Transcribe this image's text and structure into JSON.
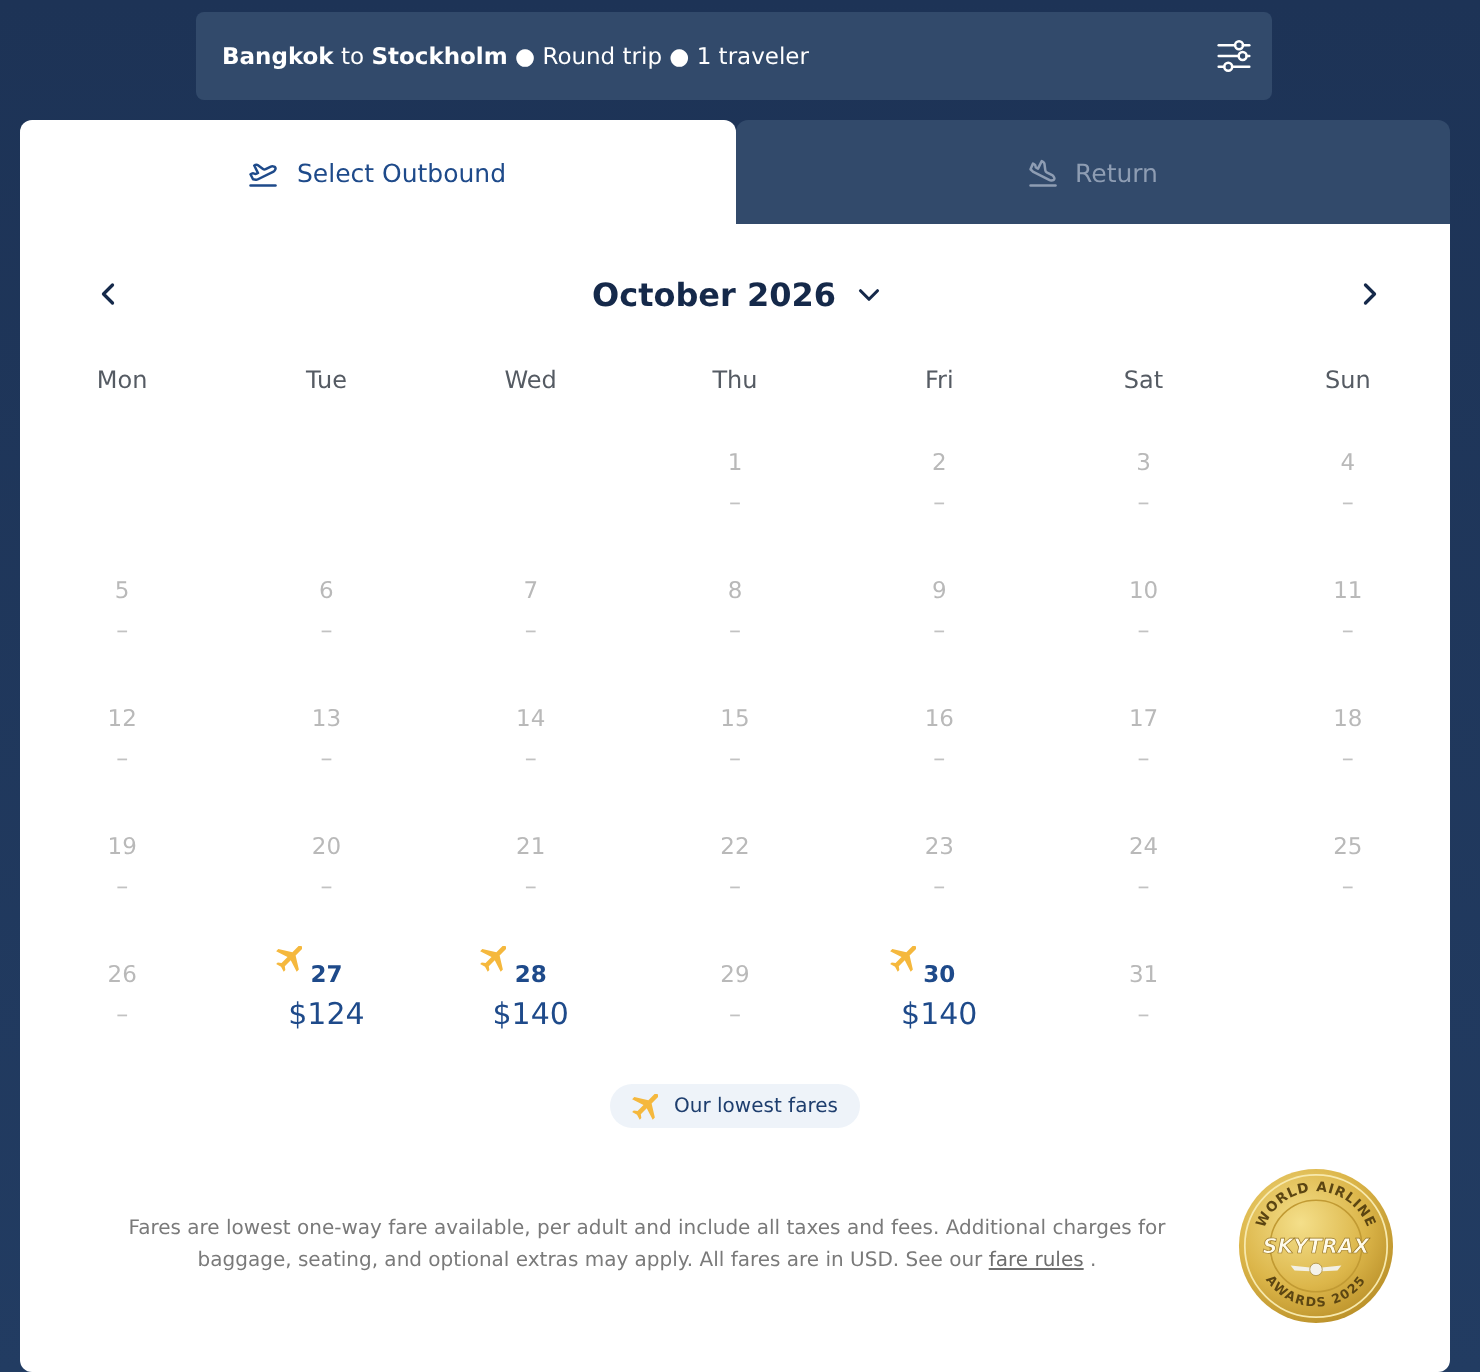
{
  "search_summary": {
    "text": "**Bangkok** to **Stockholm** ● Round trip ● 1 traveler"
  },
  "tabs": [
    {
      "kind": "outbound",
      "label": "Select Outbound",
      "selected": true
    },
    {
      "kind": "return",
      "label": "Return",
      "selected": false
    }
  ],
  "calendar": {
    "month": "October 2026",
    "weekdays": [
      "Mon",
      "Tue",
      "Wed",
      "Thu",
      "Fri",
      "Sat",
      "Sun"
    ],
    "weeks": [
      [
        {
          "day": "1",
          "available": false,
          "lowest_fare": false,
          "price": "–"
        },
        {
          "day": "2",
          "available": false,
          "lowest_fare": false,
          "price": "–"
        },
        {
          "day": "3",
          "available": false,
          "lowest_fare": false,
          "price": "–"
        },
        {
          "day": "4",
          "available": false,
          "lowest_fare": false,
          "price": "–"
        }
      ],
      [
        {
          "day": "5",
          "available": false,
          "lowest_fare": false,
          "price": "–"
        },
        {
          "day": "6",
          "available": false,
          "lowest_fare": false,
          "price": "–"
        },
        {
          "day": "7",
          "available": false,
          "lowest_fare": false,
          "price": "–"
        },
        {
          "day": "8",
          "available": false,
          "lowest_fare": false,
          "price": "–"
        },
        {
          "day": "9",
          "available": false,
          "lowest_fare": false,
          "price": "–"
        },
        {
          "day": "10",
          "available": false,
          "lowest_fare": false,
          "price": "–"
        },
        {
          "day": "11",
          "available": false,
          "lowest_fare": false,
          "price": "–"
        }
      ],
      [
        {
          "day": "12",
          "available": false,
          "lowest_fare": false,
          "price": "–"
        },
        {
          "day": "13",
          "available": false,
          "lowest_fare": false,
          "price": "–"
        },
        {
          "day": "14",
          "available": false,
          "lowest_fare": false,
          "price": "–"
        },
        {
          "day": "15",
          "available": false,
          "lowest_fare": false,
          "price": "–"
        },
        {
          "day": "16",
          "available": false,
          "lowest_fare": false,
          "price": "–"
        },
        {
          "day": "17",
          "available": false,
          "lowest_fare": false,
          "price": "–"
        },
        {
          "day": "18",
          "available": false,
          "lowest_fare": false,
          "price": "–"
        }
      ],
      [
        {
          "day": "19",
          "available": false,
          "lowest_fare": false,
          "price": "–"
        },
        {
          "day": "20",
          "available": false,
          "lowest_fare": false,
          "price": "–"
        },
        {
          "day": "21",
          "available": false,
          "lowest_fare": false,
          "price": "–"
        },
        {
          "day": "22",
          "available": false,
          "lowest_fare": false,
          "price": "–"
        },
        {
          "day": "23",
          "available": false,
          "lowest_fare": false,
          "price": "–"
        },
        {
          "day": "24",
          "available": false,
          "lowest_fare": false,
          "price": "–"
        },
        {
          "day": "25",
          "available": false,
          "lowest_fare": false,
          "price": "–"
        }
      ],
      [
        {
          "day": "26",
          "available": false,
          "lowest_fare": false,
          "price": "–"
        },
        {
          "day": "27",
          "available": true,
          "lowest_fare": true,
          "price": "$124"
        },
        {
          "day": "28",
          "available": true,
          "lowest_fare": true,
          "price": "$140"
        },
        {
          "day": "29",
          "available": false,
          "lowest_fare": false,
          "price": "–"
        },
        {
          "day": "30",
          "available": true,
          "lowest_fare": true,
          "price": "$140"
        },
        {
          "day": "31",
          "available": false,
          "lowest_fare": false,
          "price": "–"
        }
      ]
    ]
  },
  "legend": {
    "label": "Our lowest fares"
  },
  "disclaimer": {
    "text": "Fares are lowest one-way fare available, per adult and include all taxes and fees. Additional charges for baggage, seating, and optional extras may apply. All fares are in USD. See our ",
    "link": "fare rules",
    "after": " ."
  },
  "award_badge": {
    "top_text": "WORLD AIRLINE",
    "brand": "SKYTRAX",
    "bottom_text": "AWARDS 2025"
  }
}
